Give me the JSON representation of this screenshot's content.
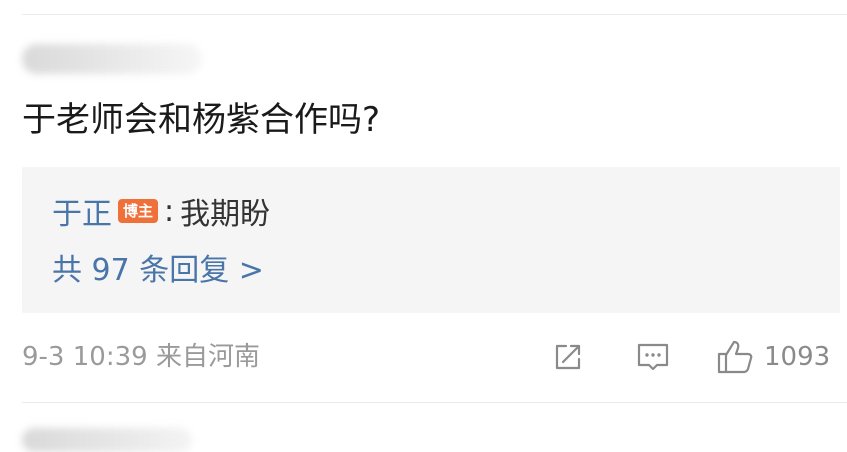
{
  "comment": {
    "text": "于老师会和杨紫合作吗?",
    "reply_author": "于正",
    "reply_badge": "博主",
    "reply_colon": ":",
    "reply_text": "我期盼",
    "more_replies": "共 97 条回复 >",
    "timestamp": "9-3 10:39",
    "location": "来自河南",
    "like_count": "1093"
  },
  "icons": {
    "share": "share-icon",
    "comment": "comment-icon",
    "like": "thumbs-up-icon"
  },
  "colors": {
    "link_blue": "#4a75a8",
    "badge_orange": "#f0703a",
    "reply_bg": "#f5f5f5",
    "meta_gray": "#9a9a9a"
  }
}
